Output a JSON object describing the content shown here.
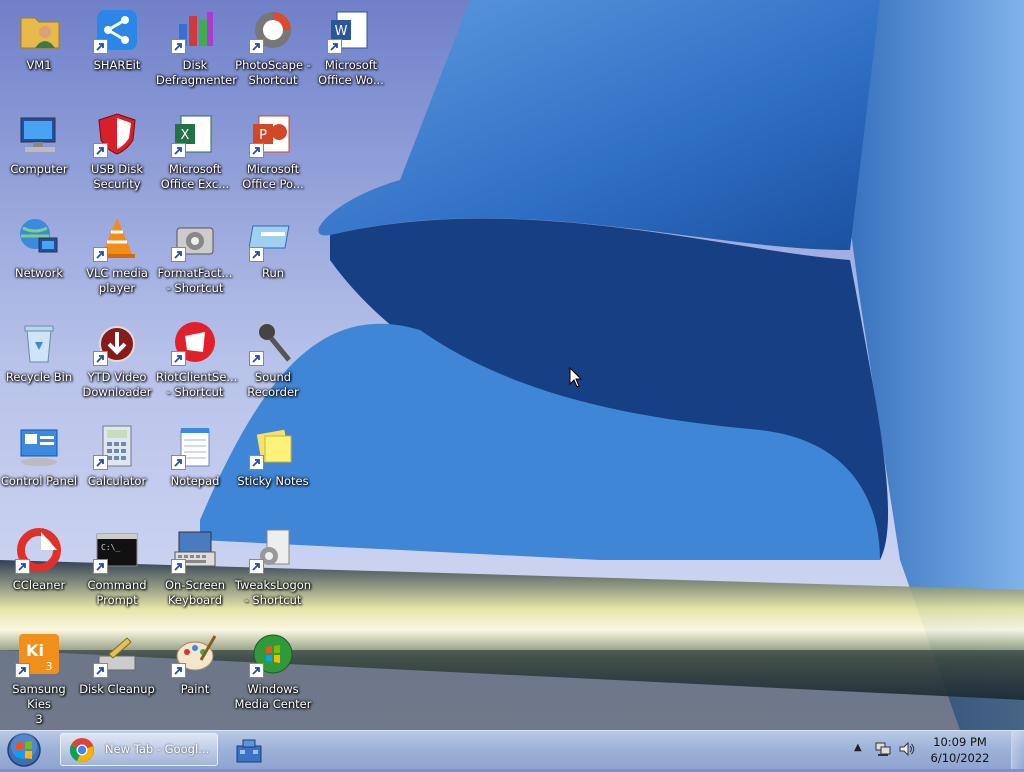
{
  "desktop": {
    "icons": [
      {
        "label": "VM1",
        "icon": "user-folder-icon",
        "shortcut": false
      },
      {
        "label": "SHAREit",
        "icon": "shareit-icon",
        "shortcut": true
      },
      {
        "label": "Disk\nDefragmenter",
        "icon": "disk-defragmenter-icon",
        "shortcut": true
      },
      {
        "label": "PhotoScape -\nShortcut",
        "icon": "photoscape-icon",
        "shortcut": true
      },
      {
        "label": "Microsoft\nOffice Wo...",
        "icon": "word-icon",
        "shortcut": true
      },
      {
        "label": "Computer",
        "icon": "computer-icon",
        "shortcut": false
      },
      {
        "label": "USB Disk\nSecurity",
        "icon": "usb-disk-security-icon",
        "shortcut": true
      },
      {
        "label": "Microsoft\nOffice Exc...",
        "icon": "excel-icon",
        "shortcut": true
      },
      {
        "label": "Microsoft\nOffice Po...",
        "icon": "powerpoint-icon",
        "shortcut": true
      },
      {
        "label": "Network",
        "icon": "network-icon",
        "shortcut": false
      },
      {
        "label": "VLC media\nplayer",
        "icon": "vlc-icon",
        "shortcut": true
      },
      {
        "label": "FormatFact...\n- Shortcut",
        "icon": "formatfactory-icon",
        "shortcut": true
      },
      {
        "label": "Run",
        "icon": "run-icon",
        "shortcut": true
      },
      {
        "label": "Recycle Bin",
        "icon": "recycle-bin-icon",
        "shortcut": false
      },
      {
        "label": "YTD Video\nDownloader",
        "icon": "ytd-icon",
        "shortcut": true
      },
      {
        "label": "RiotClientSe...\n- Shortcut",
        "icon": "riot-client-icon",
        "shortcut": true
      },
      {
        "label": "Sound\nRecorder",
        "icon": "microphone-icon",
        "shortcut": true
      },
      {
        "label": "Control Panel",
        "icon": "control-panel-icon",
        "shortcut": false
      },
      {
        "label": "Calculator",
        "icon": "calculator-icon",
        "shortcut": true
      },
      {
        "label": "Notepad",
        "icon": "notepad-icon",
        "shortcut": true
      },
      {
        "label": "Sticky Notes",
        "icon": "sticky-notes-icon",
        "shortcut": true
      },
      {
        "label": "CCleaner",
        "icon": "ccleaner-icon",
        "shortcut": true
      },
      {
        "label": "Command\nPrompt",
        "icon": "command-prompt-icon",
        "shortcut": true
      },
      {
        "label": "On-Screen\nKeyboard",
        "icon": "keyboard-icon",
        "shortcut": true
      },
      {
        "label": "TweaksLogon\n- Shortcut",
        "icon": "tweakslogon-icon",
        "shortcut": true
      },
      {
        "label": "Samsung Kies\n3",
        "icon": "samsung-kies-icon",
        "shortcut": true
      },
      {
        "label": "Disk Cleanup",
        "icon": "disk-cleanup-icon",
        "shortcut": true
      },
      {
        "label": "Paint",
        "icon": "paint-icon",
        "shortcut": true
      },
      {
        "label": "Windows\nMedia Center",
        "icon": "media-center-icon",
        "shortcut": true
      }
    ]
  },
  "taskbar": {
    "start_icon": "windows-start-orb-icon",
    "chrome_task_label": "New Tab - Googl...",
    "pinned_icon": "toolbox-icon",
    "clock_time": "10:09 PM",
    "clock_date": "6/10/2022",
    "tray_chevron": "▲"
  }
}
